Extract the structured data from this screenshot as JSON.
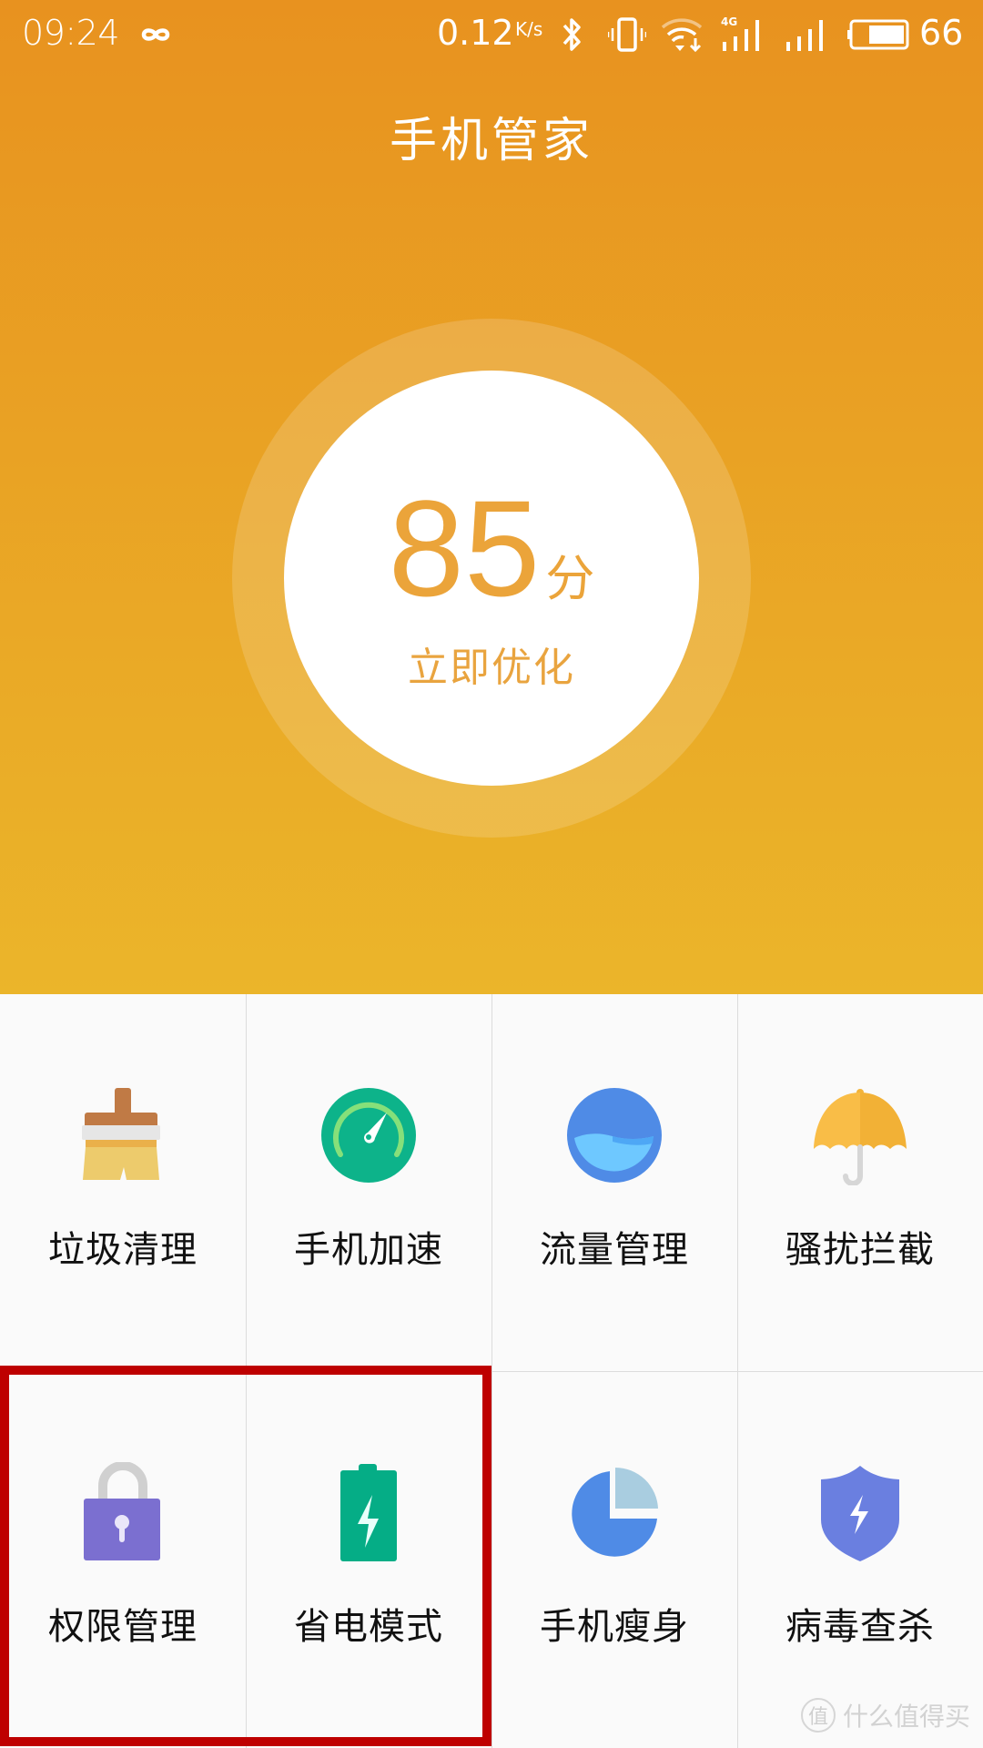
{
  "status_bar": {
    "time": "09:24",
    "net_speed": "0.12",
    "net_speed_unit": "K/s",
    "network_type": "4G",
    "battery_percent": "66",
    "icons": [
      "infinity-icon",
      "bluetooth-icon",
      "vibrate-icon",
      "wifi-icon",
      "signal-4g-icon",
      "signal-icon",
      "battery-icon"
    ]
  },
  "header": {
    "title": "手机管家",
    "score": "85",
    "score_unit": "分",
    "action": "立即优化",
    "colors": {
      "gradient_top": "#e8921f",
      "gradient_bottom": "#ebb52a",
      "score_text": "#eba43a"
    }
  },
  "tools": [
    {
      "label": "垃圾清理",
      "icon": "broom-icon"
    },
    {
      "label": "手机加速",
      "icon": "speedometer-icon"
    },
    {
      "label": "流量管理",
      "icon": "data-water-icon"
    },
    {
      "label": "骚扰拦截",
      "icon": "umbrella-icon"
    },
    {
      "label": "权限管理",
      "icon": "lock-icon"
    },
    {
      "label": "省电模式",
      "icon": "battery-charge-icon"
    },
    {
      "label": "手机瘦身",
      "icon": "pie-chart-icon"
    },
    {
      "label": "病毒查杀",
      "icon": "shield-bolt-icon"
    }
  ],
  "annotation": {
    "highlight_color": "#be0000",
    "highlighted_items": [
      "权限管理",
      "省电模式"
    ]
  },
  "watermark": {
    "badge": "值",
    "text": "什么值得买"
  }
}
